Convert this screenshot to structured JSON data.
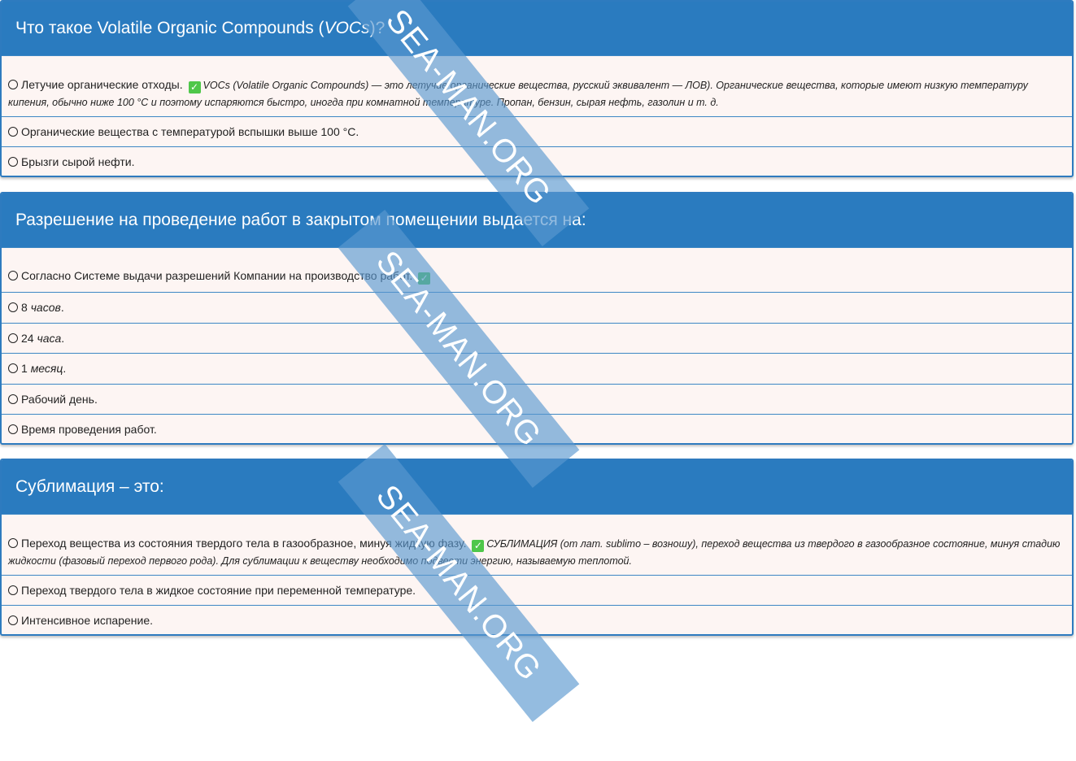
{
  "questions": [
    {
      "title_prefix": "Что такое Volatile Organic Compounds (",
      "title_em": "VOCs",
      "title_suffix": ")?",
      "options": [
        {
          "text": "Летучие органические отходы.",
          "correct": true,
          "explanation": "VOCs (Volatile Organic Compounds) — это летучие органические вещества, русский эквивалент — ЛОВ). Органические вещества, которые имеют низкую температуру кипения, обычно ниже 100 °C и поэтому испаряются быстро, иногда при комнатной температуре. Пропан, бензин, сырая нефть, газолин и т. д."
        },
        {
          "text": "Органические вещества с температурой вспышки выше 100 °C."
        },
        {
          "text": "Брызги сырой нефти."
        }
      ]
    },
    {
      "title": "Разрешение на проведение работ в закрытом помещении выдается на:",
      "options": [
        {
          "text": "Согласно Системе выдачи разрешений Компании на производство работ.",
          "correct": true
        },
        {
          "num": "8",
          "em": "часов",
          "tail": "."
        },
        {
          "num": "24",
          "em": "часа",
          "tail": "."
        },
        {
          "num": "1",
          "em": "месяц",
          "tail": "."
        },
        {
          "text": "Рабочий день."
        },
        {
          "text": "Время проведения работ."
        }
      ]
    },
    {
      "title": "Сублимация – это:",
      "options": [
        {
          "text": "Переход вещества из состояния твердого тела в газообразное, минуя жидкую фазу.",
          "correct": true,
          "explanation": "СУБЛИМАЦИЯ (от лат. sublimo – возношу), переход вещества из твердого в газообразное состояние, минуя стадию жидкости (фазовый переход первого рода). Для сублимации к веществу необходимо подвести энергию, называемую теплотой."
        },
        {
          "text": "Переход твердого тела в жидкое состояние при переменной температуре."
        },
        {
          "text": "Интенсивное испарение."
        }
      ]
    }
  ],
  "watermark": "SEA-MAN.ORG",
  "colors": {
    "header": "#2a7bbf",
    "card_bg": "#fdf5f3",
    "check": "#4fc74a",
    "watermark": "#5b98cf"
  },
  "icons": {
    "radio": "radio-empty-icon",
    "correct": "checkmark-icon"
  }
}
